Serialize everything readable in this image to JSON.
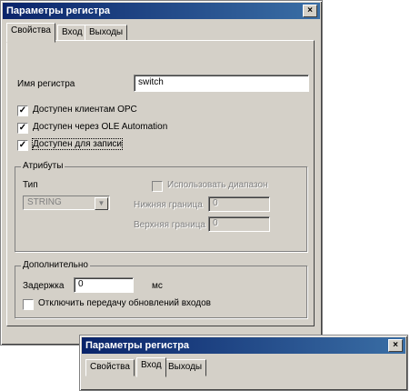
{
  "dialog1": {
    "title": "Параметры регистра",
    "close_label": "×",
    "tabs": [
      "Свойства",
      "Вход",
      "Выходы"
    ],
    "register_name_label": "Имя регистра",
    "register_name_value": "switch",
    "checkboxes": [
      {
        "label": "Доступен клиентам OPC",
        "checked": true
      },
      {
        "label": "Доступен через OLE Automation",
        "checked": true
      },
      {
        "label": "Доступен для записи",
        "checked": true
      }
    ],
    "attributes": {
      "title": "Атрибуты",
      "type_label": "Тип",
      "type_value": "STRING",
      "use_range_label": "Использовать диапазон",
      "use_range_checked": false,
      "lower_bound_label": "Нижняя граница",
      "lower_bound_value": "0",
      "upper_bound_label": "Верхняя граница",
      "upper_bound_value": "0"
    },
    "additional": {
      "title": "Дополнительно",
      "delay_label": "Задержка",
      "delay_value": "0",
      "delay_unit": "мс",
      "disable_update_label": "Отключить передачу обновлений входов",
      "disable_update_checked": false
    }
  },
  "dialog2": {
    "title": "Параметры регистра",
    "close_label": "×",
    "tabs": [
      "Свойства",
      "Вход",
      "Выходы"
    ]
  },
  "icons": {
    "check": "✓",
    "combo_arrow": "▼"
  }
}
